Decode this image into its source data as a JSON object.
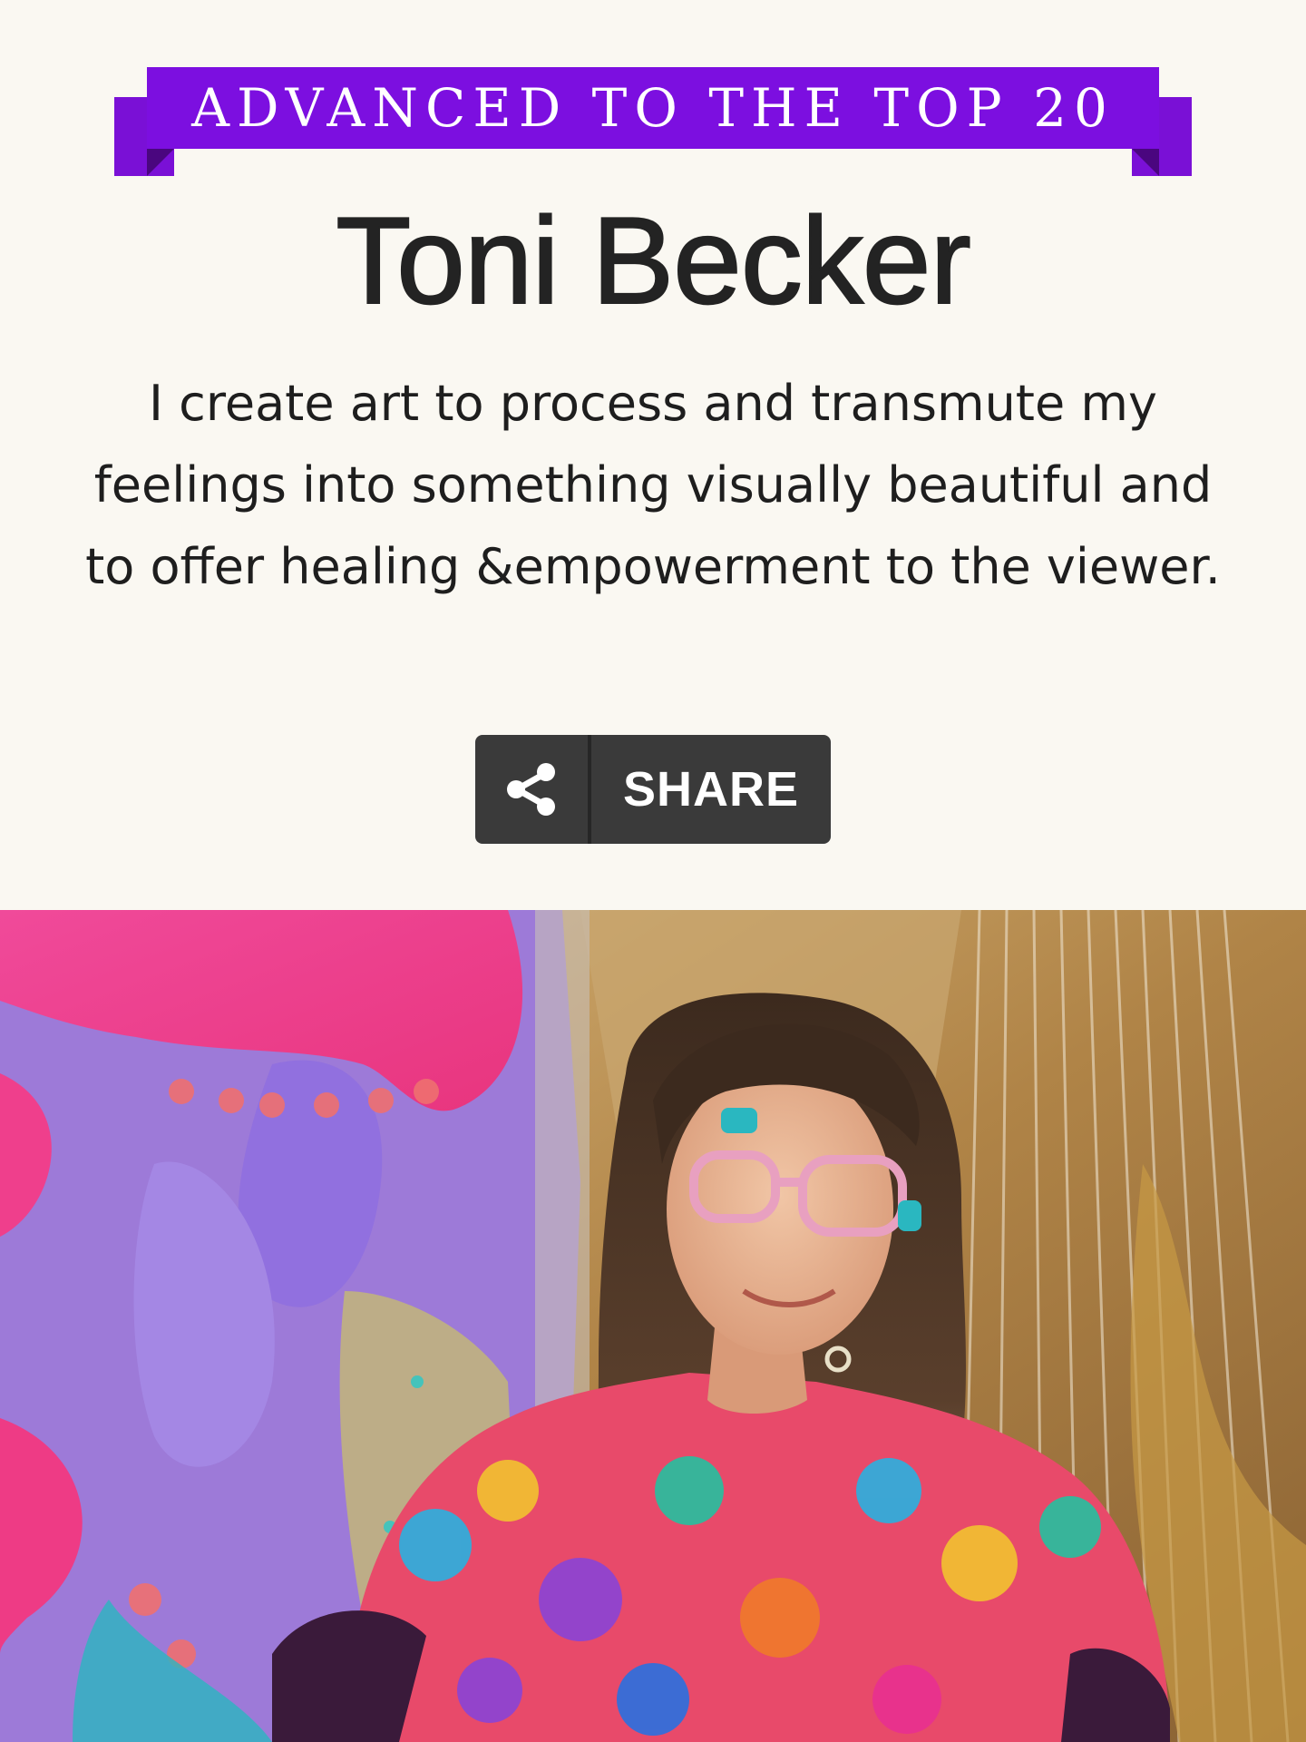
{
  "banner": {
    "text": "ADVANCED TO THE TOP 20",
    "color": "#7c0fe0"
  },
  "profile": {
    "name": "Toni Becker",
    "bio": "I create art to process and transmute my feelings into something visually beautiful and to offer healing &empowerment to the viewer."
  },
  "share": {
    "label": "SHARE",
    "icon": "share-icon"
  },
  "photo": {
    "subject": "portrait-photo"
  }
}
